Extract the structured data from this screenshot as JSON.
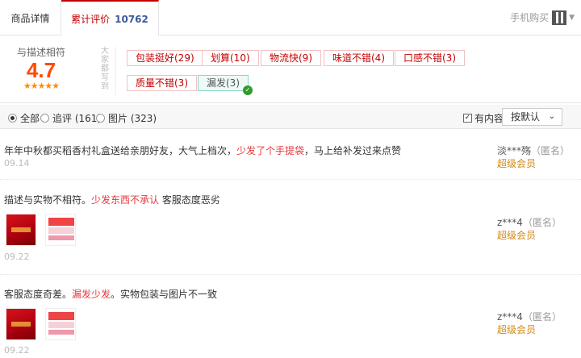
{
  "tabs": {
    "detail_label": "商品详情",
    "reviews_label": "累计评价",
    "reviews_count": "10762",
    "mobile_buy_label": "手机购买"
  },
  "summary": {
    "score_label": "与描述相符",
    "score": "4.7",
    "stars": "★★★★★",
    "side_label": "大家都写到",
    "tags": [
      {
        "label": "包装挺好(29)",
        "sentiment": "positive"
      },
      {
        "label": "划算(10)",
        "sentiment": "positive"
      },
      {
        "label": "物流快(9)",
        "sentiment": "positive"
      },
      {
        "label": "味道不错(4)",
        "sentiment": "positive"
      },
      {
        "label": "口感不错(3)",
        "sentiment": "positive"
      },
      {
        "label": "质量不错(3)",
        "sentiment": "positive"
      },
      {
        "label": "漏发(3)",
        "sentiment": "negative",
        "selected": true
      }
    ]
  },
  "filters": {
    "all_label": "全部",
    "followup_label": "追评 (161)",
    "pictures_label": "图片 (323)",
    "has_content_label": "有内容",
    "sort_label": "按默认"
  },
  "reviews": [
    {
      "text_pre": "年年中秋都买稻香村礼盒送给亲朋好友，大气上档次，",
      "text_hl": "少发了个手提袋",
      "text_post": "，马上给补发过来点赞",
      "date": "09.14",
      "user": "淡***殇",
      "anon": "（匿名）",
      "level": "超级会员"
    },
    {
      "text_pre": "描述与实物不相符。",
      "text_hl": "少发东西不承认",
      "text_post": " 客服态度恶劣",
      "date": "09.22",
      "user": "z***4",
      "anon": "（匿名）",
      "level": "超级会员"
    },
    {
      "text_pre": "客服态度奇差。",
      "text_hl": "漏发少发",
      "text_post": "。实物包装与图片不一致",
      "date": "09.22",
      "user": "z***4",
      "anon": "（匿名）",
      "level": "超级会员"
    }
  ],
  "colors": {
    "accent": "#c40000",
    "score": "#ff4a00",
    "member": "#d08a1a",
    "date": "#bbbbbb"
  }
}
